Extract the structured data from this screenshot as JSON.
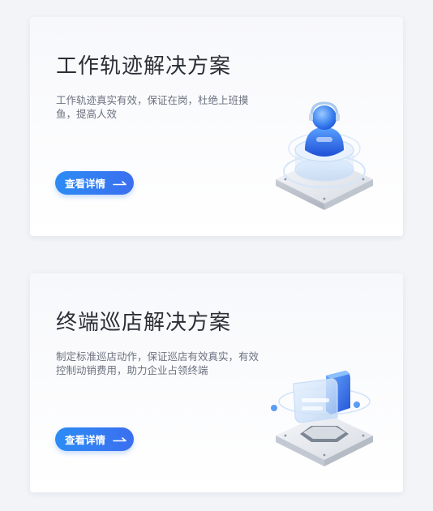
{
  "cards": [
    {
      "title": "工作轨迹解决方案",
      "description": "工作轨迹真实有效，保证在岗，杜绝上班摸鱼，提高人效",
      "button_label": "查看详情",
      "icon": "arrow-right-icon",
      "illustration": "person-on-platform-illustration"
    },
    {
      "title": "终端巡店解决方案",
      "description": "制定标准巡店动作，保证巡店有效真实，有效控制动销费用，助力企业占领终端",
      "button_label": "查看详情",
      "icon": "arrow-right-icon",
      "illustration": "store-on-platform-illustration"
    }
  ],
  "colors": {
    "page_background": "#f2f4f8",
    "button_start": "#2c8cf4",
    "button_end": "#3b6ff0",
    "title": "#2b2f36",
    "description": "#6b7280"
  }
}
